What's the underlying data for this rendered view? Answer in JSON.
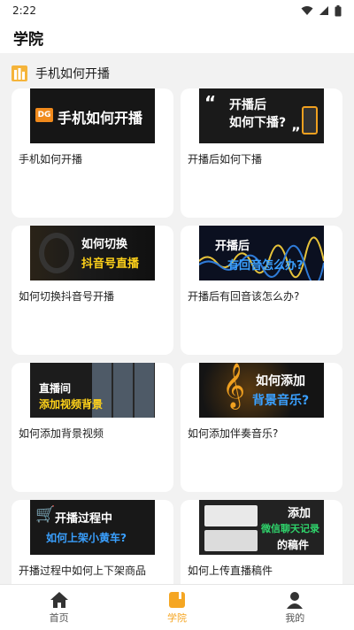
{
  "status_bar": {
    "time": "2:22"
  },
  "header": {
    "title": "学院"
  },
  "section": {
    "title": "手机如何开播"
  },
  "cards": [
    {
      "title": "手机如何开播",
      "thumb_lines": [
        "手机如何开播"
      ],
      "thumb_badge": "DG"
    },
    {
      "title": "开播后如何下播",
      "thumb_lines": [
        "开播后",
        "如何下播?"
      ]
    },
    {
      "title": "如何切换抖音号开播",
      "thumb_lines": [
        "如何切换",
        "抖音号直播"
      ]
    },
    {
      "title": "开播后有回音该怎么办?",
      "thumb_lines": [
        "开播后",
        "有回音怎么办?"
      ]
    },
    {
      "title": "如何添加背景视频",
      "thumb_lines": [
        "直播间",
        "添加视频背景"
      ]
    },
    {
      "title": "如何添加伴奏音乐?",
      "thumb_lines": [
        "如何添加",
        "背景音乐?"
      ]
    },
    {
      "title": "开播过程中如何上下架商品",
      "thumb_lines": [
        "开播过程中",
        "如何上架小黄车?"
      ]
    },
    {
      "title": "如何上传直播稿件",
      "thumb_lines": [
        "添加",
        "微信聊天记录",
        "的稿件"
      ]
    }
  ],
  "tabs": [
    {
      "label": "首页",
      "icon": "home-icon"
    },
    {
      "label": "学院",
      "icon": "academy-icon"
    },
    {
      "label": "我的",
      "icon": "profile-icon"
    }
  ],
  "colors": {
    "accent": "#f5a623",
    "background": "#f2f2f2"
  }
}
